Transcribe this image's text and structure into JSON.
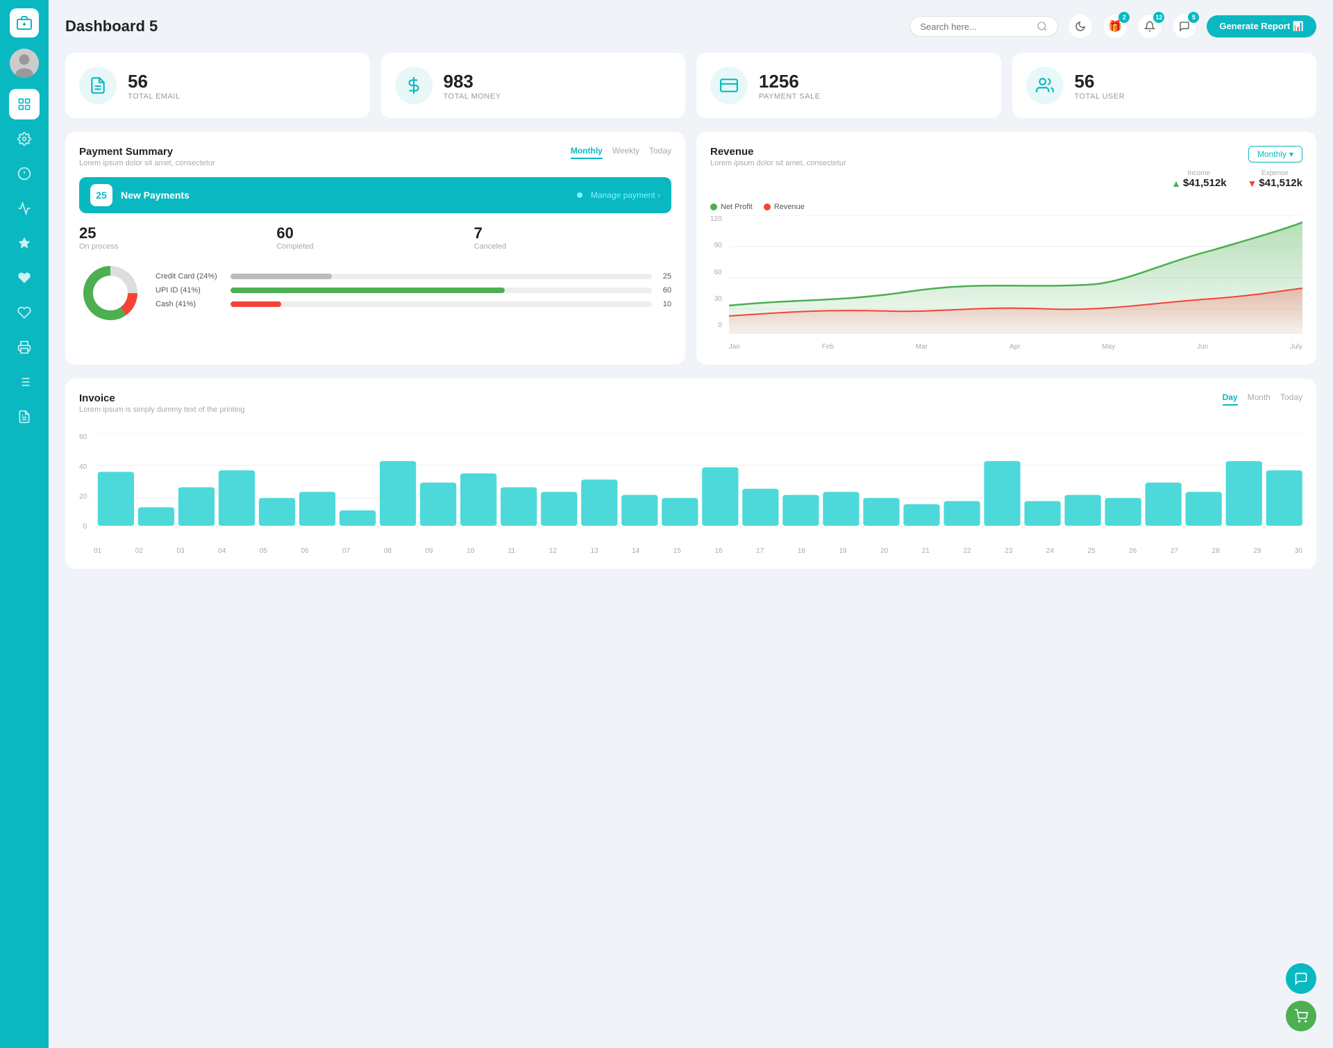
{
  "sidebar": {
    "logo_icon": "💼",
    "items": [
      {
        "id": "avatar",
        "icon": "👤",
        "active": false
      },
      {
        "id": "dashboard",
        "icon": "⊞",
        "active": true
      },
      {
        "id": "settings",
        "icon": "⚙",
        "active": false
      },
      {
        "id": "info",
        "icon": "ℹ",
        "active": false
      },
      {
        "id": "chart",
        "icon": "📊",
        "active": false
      },
      {
        "id": "star",
        "icon": "★",
        "active": false
      },
      {
        "id": "heart",
        "icon": "♥",
        "active": false
      },
      {
        "id": "heart2",
        "icon": "♥",
        "active": false
      },
      {
        "id": "print",
        "icon": "🖨",
        "active": false
      },
      {
        "id": "list",
        "icon": "≡",
        "active": false
      },
      {
        "id": "doc",
        "icon": "📋",
        "active": false
      }
    ]
  },
  "header": {
    "title": "Dashboard 5",
    "search_placeholder": "Search here...",
    "generate_btn": "Generate Report",
    "badges": {
      "gift": "2",
      "bell": "12",
      "chat": "5"
    }
  },
  "stats": [
    {
      "id": "email",
      "value": "56",
      "label": "TOTAL EMAIL",
      "icon": "📋"
    },
    {
      "id": "money",
      "value": "983",
      "label": "TOTAL MONEY",
      "icon": "💲"
    },
    {
      "id": "payment",
      "value": "1256",
      "label": "PAYMENT SALE",
      "icon": "💳"
    },
    {
      "id": "user",
      "value": "56",
      "label": "TOTAL USER",
      "icon": "👥"
    }
  ],
  "payment_summary": {
    "title": "Payment Summary",
    "subtitle": "Lorem ipsum dolor sit amet, consectetur",
    "tabs": [
      "Monthly",
      "Weekly",
      "Today"
    ],
    "active_tab": "Monthly",
    "new_payments_count": "25",
    "new_payments_label": "New Payments",
    "manage_link": "Manage payment",
    "stats": [
      {
        "value": "25",
        "label": "On process"
      },
      {
        "value": "60",
        "label": "Completed"
      },
      {
        "value": "7",
        "label": "Canceled"
      }
    ],
    "progress_bars": [
      {
        "label": "Credit Card (24%)",
        "value": 24,
        "fill": "#bbb",
        "count": "25"
      },
      {
        "label": "UPI ID (41%)",
        "value": 65,
        "fill": "#4caf50",
        "count": "60"
      },
      {
        "label": "Cash (41%)",
        "value": 12,
        "fill": "#f44336",
        "count": "10"
      }
    ],
    "donut": {
      "segments": [
        {
          "color": "#4caf50",
          "pct": 60
        },
        {
          "color": "#f44336",
          "pct": 15
        },
        {
          "color": "#ddd",
          "pct": 25
        }
      ]
    }
  },
  "revenue": {
    "title": "Revenue",
    "subtitle": "Lorem ipsum dolor sit amet, consectetur",
    "monthly_btn": "Monthly",
    "income": {
      "label": "Income",
      "value": "$41,512k"
    },
    "expense": {
      "label": "Expense",
      "value": "$41,512k"
    },
    "legend": [
      {
        "label": "Net Profit",
        "color": "#4caf50"
      },
      {
        "label": "Revenue",
        "color": "#f44336"
      }
    ],
    "x_labels": [
      "Jan",
      "Feb",
      "Mar",
      "Apr",
      "May",
      "Jun",
      "July"
    ],
    "y_labels": [
      "0",
      "30",
      "60",
      "90",
      "120"
    ],
    "net_profit_points": "0,320 80,290 160,300 240,270 320,285 400,280 480,200 560,180 640,120",
    "revenue_points": "0,340 80,330 160,310 240,320 320,300 400,310 480,290 560,270 640,250"
  },
  "invoice": {
    "title": "Invoice",
    "subtitle": "Lorem ipsum is simply dummy text of the printing",
    "tabs": [
      "Day",
      "Month",
      "Today"
    ],
    "active_tab": "Day",
    "y_labels": [
      "0",
      "20",
      "40",
      "60"
    ],
    "x_labels": [
      "01",
      "02",
      "03",
      "04",
      "05",
      "06",
      "07",
      "08",
      "09",
      "10",
      "11",
      "12",
      "13",
      "14",
      "15",
      "16",
      "17",
      "18",
      "19",
      "20",
      "21",
      "22",
      "23",
      "24",
      "25",
      "26",
      "27",
      "28",
      "29",
      "30"
    ],
    "bars": [
      35,
      12,
      25,
      36,
      18,
      22,
      10,
      42,
      28,
      34,
      25,
      22,
      30,
      20,
      18,
      38,
      24,
      20,
      22,
      18,
      14,
      16,
      42,
      16,
      20,
      18,
      28,
      22,
      42,
      36
    ]
  },
  "floats": [
    {
      "icon": "💬",
      "color": "teal"
    },
    {
      "icon": "🛒",
      "color": "green"
    }
  ]
}
